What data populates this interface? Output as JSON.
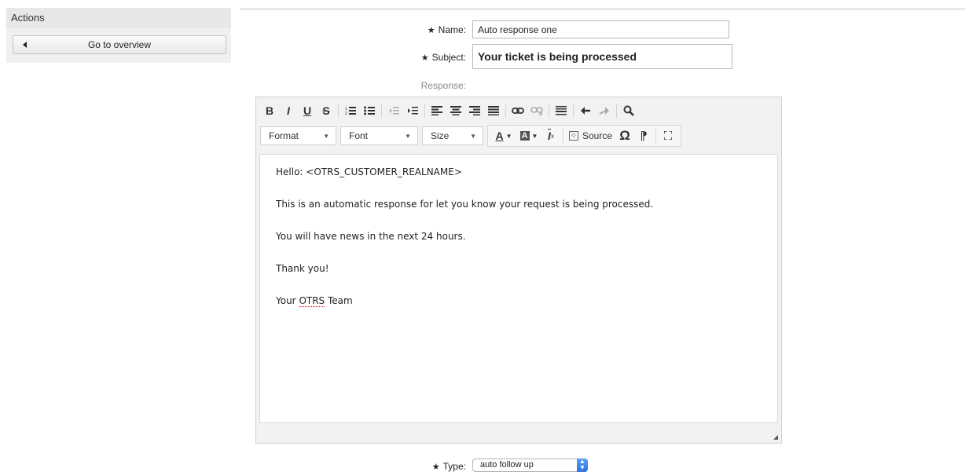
{
  "sidebar": {
    "title": "Actions",
    "overview_button": "Go to overview"
  },
  "form": {
    "name_label": "Name:",
    "name_value": "Auto response one",
    "subject_label": "Subject:",
    "subject_value": "Your ticket is being processed",
    "response_label": "Response:",
    "type_label": "Type:",
    "type_value": "auto follow up",
    "required_marker": "★"
  },
  "editor": {
    "toolbar_row1": [
      "bold-icon",
      "italic-icon",
      "underline-icon",
      "strikethrough-icon",
      "ordered-list-icon",
      "bullet-list-icon",
      "outdent-icon",
      "indent-icon",
      "align-left-icon",
      "align-center-icon",
      "align-right-icon",
      "align-justify-icon",
      "link-icon",
      "unlink-icon",
      "horizontal-rule-icon",
      "undo-icon",
      "redo-icon",
      "find-icon"
    ],
    "format_label": "Format",
    "font_label": "Font",
    "size_label": "Size",
    "text_color_label": "A",
    "bg_color_label": "A",
    "remove_format_label": "I",
    "source_label": "Source",
    "special_char_label": "Ω",
    "paragraph_mark_label": "⁋",
    "maximize_label": "⛶",
    "content": {
      "line1": "Hello: <OTRS_CUSTOMER_REALNAME>",
      "line2": "This is an automatic response for let you know your request is being processed.",
      "line3": "You will have news in the next 24 hours.",
      "line4": "Thank you!",
      "line5_prefix": "Your ",
      "line5_misspelled": "OTRS",
      "line5_suffix": " Team"
    }
  }
}
